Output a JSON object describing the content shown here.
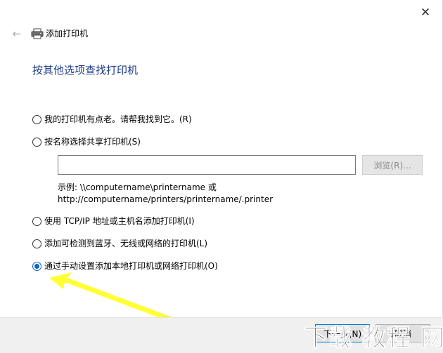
{
  "header": {
    "title": "添加打印机",
    "back_icon": "back-arrow-icon",
    "printer_icon": "printer-icon",
    "close_icon": "close-icon"
  },
  "page": {
    "heading": "按其他选项查找打印机"
  },
  "options": [
    {
      "label": "我的打印机有点老。请帮我找到它。(R)",
      "checked": false
    },
    {
      "label": "按名称选择共享打印机(S)",
      "checked": false
    },
    {
      "label": "使用 TCP/IP 地址或主机名添加打印机(I)",
      "checked": false
    },
    {
      "label": "添加可检测到蓝牙、无线或网络的打印机(L)",
      "checked": false
    },
    {
      "label": "通过手动设置添加本地打印机或网络打印机(O)",
      "checked": true
    }
  ],
  "share": {
    "input_value": "",
    "browse_label": "浏览(R)...",
    "example_line1": "示例: \\\\computername\\printername 或",
    "example_line2": "http://computername/printers/printername/.printer"
  },
  "footer": {
    "next_label": "下一步(N)",
    "cancel_label": "取消"
  },
  "annotation": {
    "arrow_color": "#ffff33"
  },
  "watermark": {
    "text": "下载 教程 网"
  },
  "colors": {
    "heading": "#1e3b87",
    "radio_checked": "#0a63c9"
  }
}
